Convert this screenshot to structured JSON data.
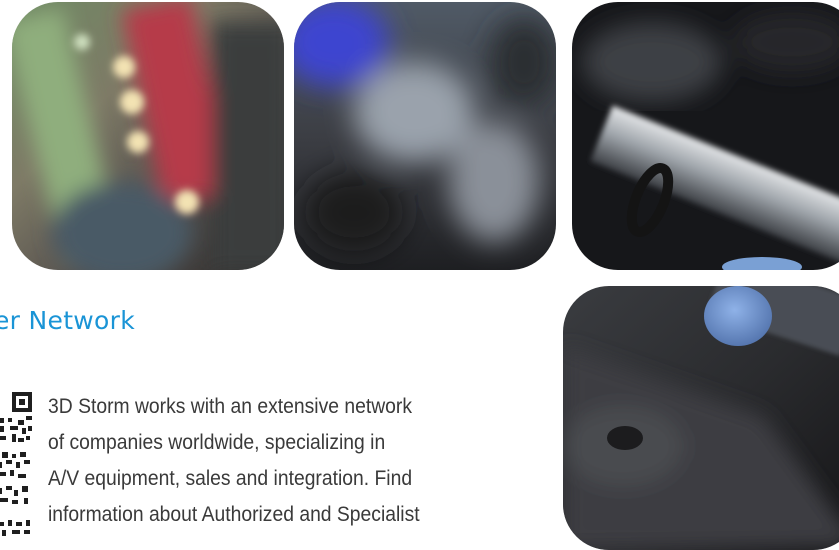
{
  "section": {
    "heading": "er Network",
    "body_lines": [
      "3D Storm works with an extensive network",
      "of companies worldwide, specializing in",
      "A/V equipment, sales and integration. Find",
      "information about Authorized and Specialist"
    ]
  },
  "photos": [
    {
      "name": "bokeh-lights-photo"
    },
    {
      "name": "blurred-equipment-photo"
    },
    {
      "name": "metal-cylinder-photo"
    },
    {
      "name": "blue-cap-device-photo"
    }
  ],
  "colors": {
    "heading": "#1a94d6",
    "body_text": "#3a3a3a"
  }
}
